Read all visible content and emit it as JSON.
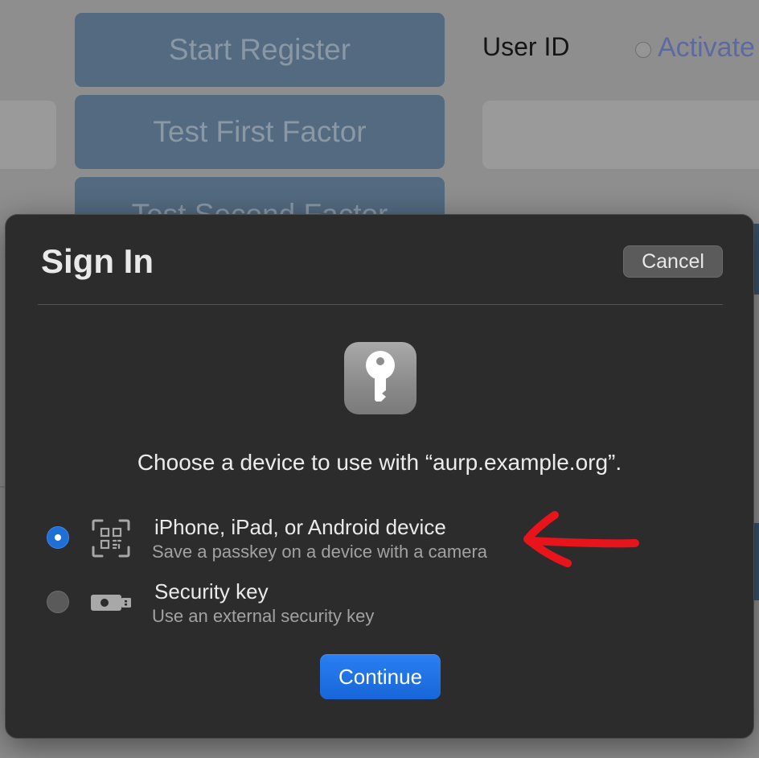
{
  "background": {
    "buttons": [
      "Start Register",
      "Test First Factor",
      "Test Second Factor"
    ],
    "user_id_label": "User ID",
    "activate_label": "Activate"
  },
  "dialog": {
    "title": "Sign In",
    "cancel_label": "Cancel",
    "app_icon": "key-icon",
    "prompt": "Choose a device to use with “aurp.example.org”.",
    "options": [
      {
        "title": "iPhone, iPad, or Android device",
        "subtitle": "Save a passkey on a device with a camera",
        "icon": "qr-code-icon",
        "selected": true
      },
      {
        "title": "Security key",
        "subtitle": "Use an external security key",
        "icon": "usb-key-icon",
        "selected": false
      }
    ],
    "continue_label": "Continue"
  },
  "colors": {
    "accent": "#1f6fd6",
    "annotation_arrow": "#e8141c",
    "dialog_bg": "#2c2c2c"
  }
}
